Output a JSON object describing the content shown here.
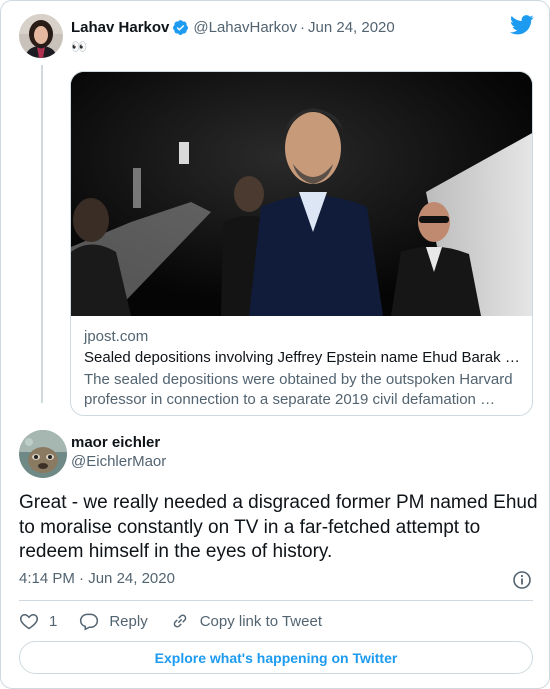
{
  "tweet1": {
    "name": "Lahav Harkov",
    "handle": "@LahavHarkov",
    "date": "Jun 24, 2020",
    "text": "👀",
    "card": {
      "domain": "jpost.com",
      "title": "Sealed depositions involving Jeffrey Epstein name Ehud Barak …",
      "description": "The sealed depositions were obtained by the outspoken Harvard professor in connection to a separate 2019 civil defamation …"
    }
  },
  "tweet2": {
    "name": "maor eichler",
    "handle": "@EichlerMaor",
    "text": "Great - we really needed a disgraced former PM named Ehud to moralise constantly on TV in a far-fetched attempt to redeem himself in the eyes of history.",
    "time": "4:14 PM",
    "date": "Jun 24, 2020",
    "likes": "1",
    "reply_label": "Reply",
    "copy_link_label": "Copy link to Tweet"
  },
  "explore_label": "Explore what's happening on Twitter",
  "colors": {
    "brand": "#1d9bf0",
    "text": "#0f1419",
    "secondary": "#536471",
    "border": "#cfd9de"
  },
  "icons": [
    "verified-badge-icon",
    "twitter-bird-icon",
    "info-icon",
    "heart-icon",
    "reply-bubble-icon",
    "link-icon"
  ]
}
